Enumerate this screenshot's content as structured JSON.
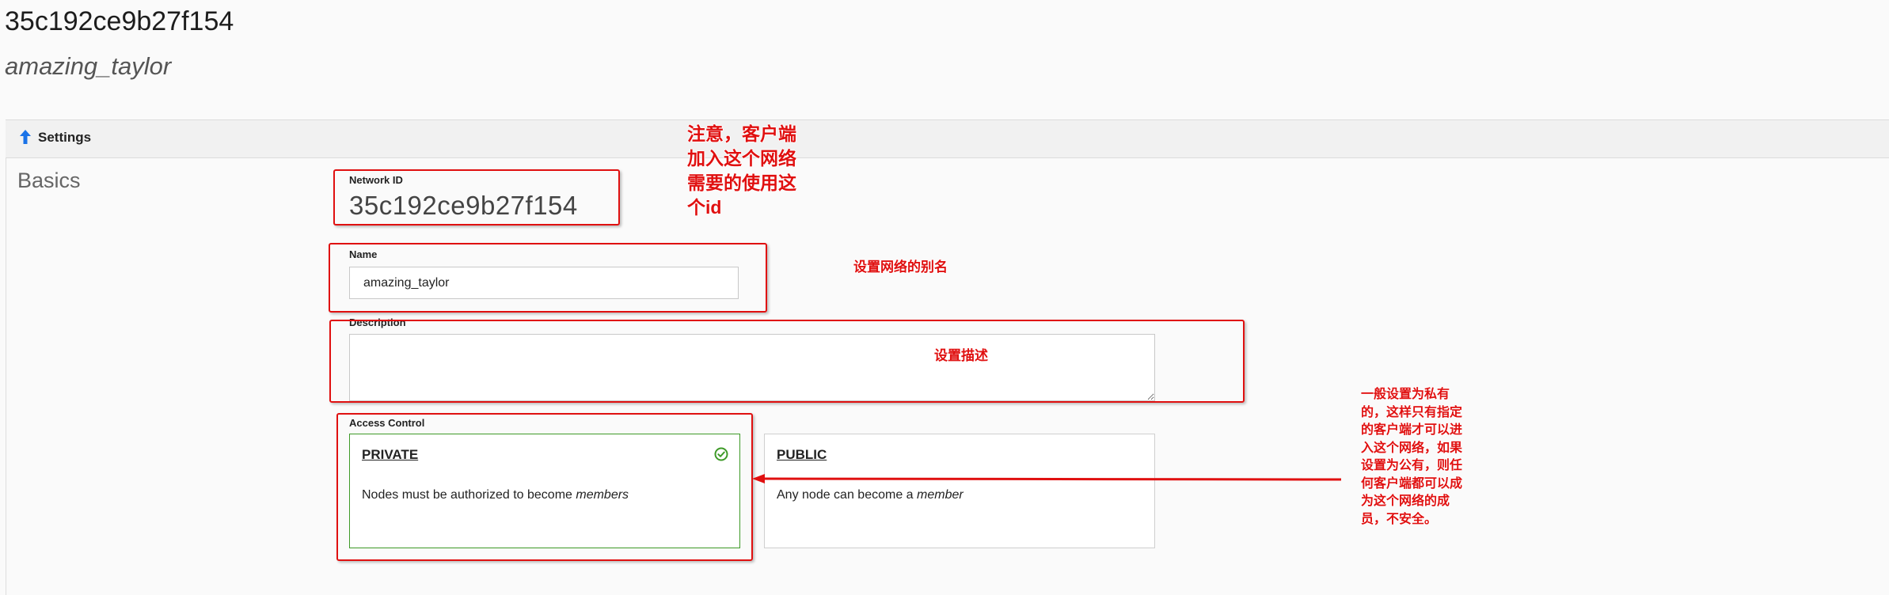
{
  "network": {
    "id_title": "35c192ce9b27f154",
    "name_subtitle": "amazing_taylor"
  },
  "settings": {
    "header_label": "Settings",
    "section_heading": "Basics",
    "network_id_label": "Network ID",
    "network_id_value": "35c192ce9b27f154",
    "name_label": "Name",
    "name_value": "amazing_taylor",
    "description_label": "Description",
    "description_value": "",
    "access_control_label": "Access Control",
    "access_options": [
      {
        "title": "PRIVATE",
        "desc_prefix": "Nodes must be authorized to become ",
        "desc_emph": "members",
        "selected": true
      },
      {
        "title": "PUBLIC",
        "desc_prefix": "Any node can become a ",
        "desc_emph": "member",
        "selected": false
      }
    ]
  },
  "annotations": {
    "network_id_note": [
      "注意，客户端",
      "加入这个网络",
      "需要的使用这",
      "个id"
    ],
    "name_note": "设置网络的别名",
    "description_note": "设置描述",
    "access_note": [
      "一般设置为私有",
      "的，这样只有指定",
      "的客户端才可以进",
      "入这个网络，如果",
      "设置为公有，则任",
      "何客户端都可以成",
      "为这个网络的成",
      "员，不安全。"
    ]
  },
  "colors": {
    "accent_blue": "#1a73e8",
    "selected_green": "#3e9a28",
    "annotation_red": "#e01010"
  },
  "icons": {
    "header": "arrow-up-icon",
    "private_selected": "check-circle-icon"
  }
}
